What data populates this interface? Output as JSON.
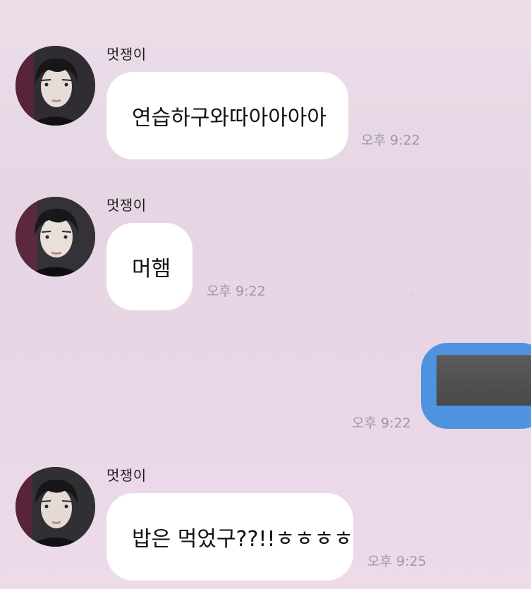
{
  "colors": {
    "background": "#e8d8e6",
    "bubble_incoming": "#ffffff",
    "bubble_outgoing": "#4f93e0",
    "timestamp": "#9d98a0"
  },
  "messages": [
    {
      "sender": "멋쟁이",
      "text": "연습하구와따아아아아",
      "time": "오후 9:22"
    },
    {
      "sender": "멋쟁이",
      "text": "머햄",
      "time": "오후 9:22"
    },
    {
      "sender": "",
      "text": "",
      "time": "오후 9:22"
    },
    {
      "sender": "멋쟁이",
      "text": "밥은 먹었구??!!ㅎㅎㅎㅎ",
      "time": "오후 9:25"
    }
  ]
}
